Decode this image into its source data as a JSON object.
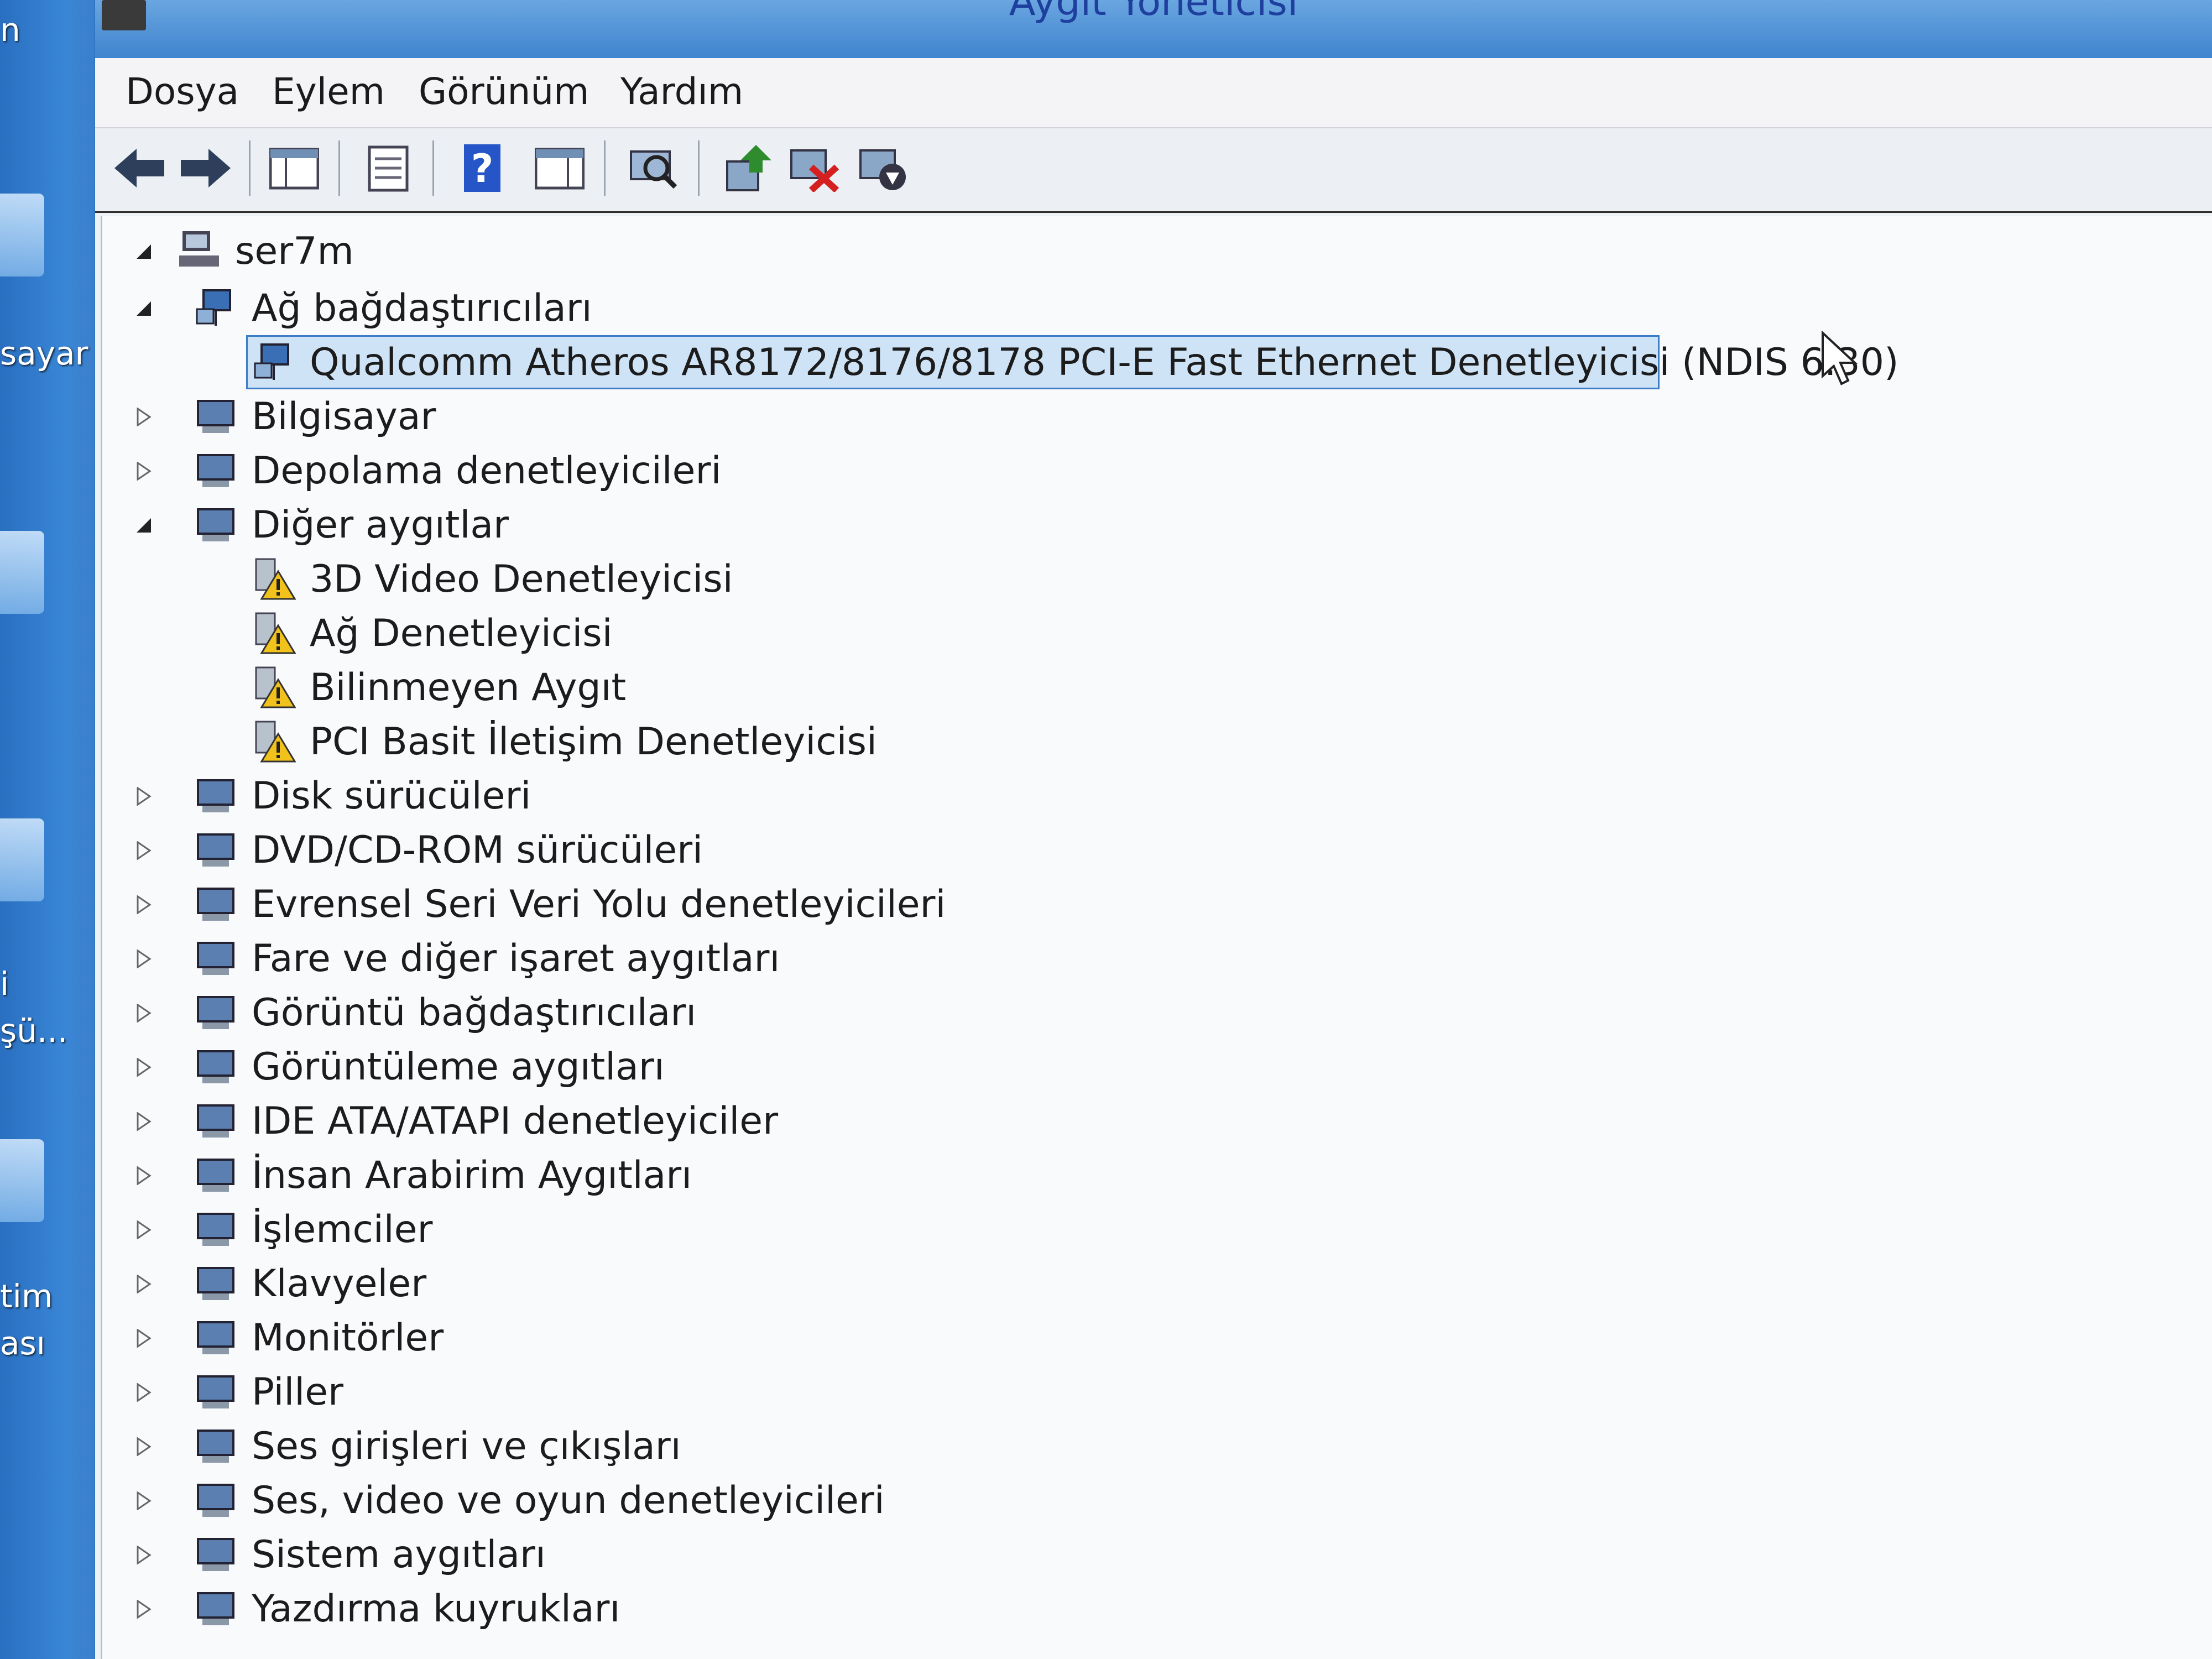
{
  "desktop": {
    "labels": [
      "n",
      "sayar",
      "i",
      "şü...",
      "tim",
      "ası"
    ]
  },
  "window": {
    "title": "Aygıt Yöneticisi"
  },
  "menu": {
    "items": [
      "Dosya",
      "Eylem",
      "Görünüm",
      "Yardım"
    ]
  },
  "toolbar": {
    "buttons": [
      "back-icon",
      "forward-icon",
      "show-hide-console-tree-icon",
      "properties-icon",
      "help-icon",
      "show-hide-action-pane-icon",
      "scan-hardware-icon",
      "update-driver-icon",
      "uninstall-device-icon",
      "disable-device-icon"
    ]
  },
  "tree": {
    "root": "ser7m",
    "nodes": [
      {
        "label": "Ağ bağdaştırıcıları",
        "expanded": true,
        "icon": "network-adapter-icon"
      },
      {
        "label": "Qualcomm Atheros AR8172/8176/8178 PCI-E Fast Ethernet Denetleyicisi (NDIS 6.30)",
        "selected": true,
        "icon": "network-adapter-icon"
      },
      {
        "label": "Bilgisayar",
        "icon": "computer-icon"
      },
      {
        "label": "Depolama denetleyicileri",
        "icon": "storage-controller-icon"
      },
      {
        "label": "Diğer aygıtlar",
        "expanded": true,
        "icon": "unknown-device-icon"
      },
      {
        "label": "3D Video Denetleyicisi",
        "icon": "warning-device-icon"
      },
      {
        "label": "Ağ Denetleyicisi",
        "icon": "warning-device-icon"
      },
      {
        "label": "Bilinmeyen Aygıt",
        "icon": "warning-device-icon"
      },
      {
        "label": "PCI Basit İletişim Denetleyicisi",
        "icon": "warning-device-icon"
      },
      {
        "label": "Disk sürücüleri",
        "icon": "disk-drive-icon"
      },
      {
        "label": "DVD/CD-ROM sürücüleri",
        "icon": "dvd-drive-icon"
      },
      {
        "label": "Evrensel Seri Veri Yolu denetleyicileri",
        "icon": "usb-icon"
      },
      {
        "label": "Fare ve diğer işaret aygıtları",
        "icon": "mouse-icon"
      },
      {
        "label": "Görüntü bağdaştırıcıları",
        "icon": "display-adapter-icon"
      },
      {
        "label": "Görüntüleme aygıtları",
        "icon": "imaging-device-icon"
      },
      {
        "label": "IDE ATA/ATAPI denetleyiciler",
        "icon": "ide-controller-icon"
      },
      {
        "label": "İnsan Arabirim Aygıtları",
        "icon": "hid-icon"
      },
      {
        "label": "İşlemciler",
        "icon": "processor-icon"
      },
      {
        "label": "Klavyeler",
        "icon": "keyboard-icon"
      },
      {
        "label": "Monitörler",
        "icon": "monitor-icon"
      },
      {
        "label": "Piller",
        "icon": "battery-icon"
      },
      {
        "label": "Ses girişleri ve çıkışları",
        "icon": "speaker-icon"
      },
      {
        "label": "Ses, video ve oyun denetleyicileri",
        "icon": "speaker-icon"
      },
      {
        "label": "Sistem aygıtları",
        "icon": "system-device-icon"
      },
      {
        "label": "Yazdırma kuyrukları",
        "icon": "printer-icon"
      }
    ]
  },
  "colors": {
    "selection_bg": "#cfe3f7",
    "selection_border": "#3d7dc8",
    "desktop_blue": "#2f78c8",
    "title_text": "#1f3f9e"
  }
}
